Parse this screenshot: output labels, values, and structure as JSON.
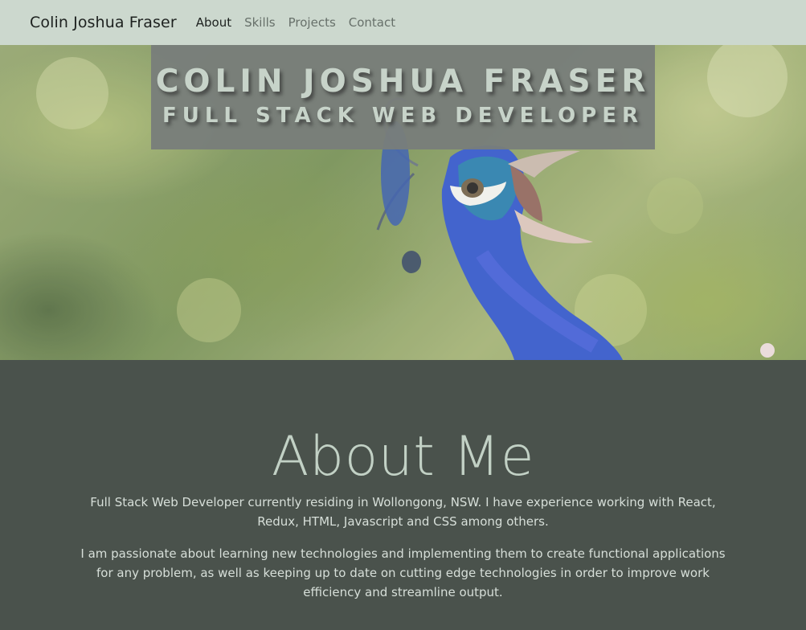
{
  "nav": {
    "brand": "Colin Joshua Fraser",
    "links": [
      "About",
      "Skills",
      "Projects",
      "Contact"
    ],
    "active_index": 0
  },
  "hero": {
    "name": "COLIN JOSHUA FRASER",
    "role": "FULL STACK WEB DEVELOPER"
  },
  "about": {
    "heading": "About Me",
    "paragraph1": "Full Stack Web Developer currently residing in Wollongong, NSW. I have experience working with React, Redux, HTML, Javascript and CSS among others.",
    "paragraph2": "I am passionate about learning new technologies and implementing them to create functional applications for any problem, as well as keeping up to date on cutting edge technologies in order to improve work efficiency and streamline output."
  },
  "colors": {
    "navbar_bg": "#ccd8ce",
    "about_bg": "#4a524c",
    "accent_text": "#c2d1c5"
  }
}
